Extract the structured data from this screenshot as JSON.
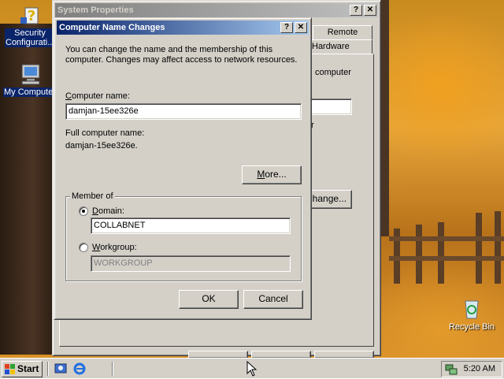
{
  "desktop": {
    "icons": [
      {
        "label": "Security Configurati...",
        "icon": "security-config-icon"
      },
      {
        "label": "My Computer",
        "icon": "my-computer-icon"
      },
      {
        "label": "Recycle Bin",
        "icon": "recycle-bin-icon"
      }
    ]
  },
  "system_properties": {
    "title": "System Properties",
    "tabs": [
      "Remote",
      "Hardware"
    ],
    "partial_text_1": "computer",
    "partial_text_2": "r",
    "change_button_label": "Change...",
    "title_buttons": [
      "?",
      "✕"
    ]
  },
  "dialog": {
    "title": "Computer Name Changes",
    "title_buttons": [
      "?",
      "✕"
    ],
    "description": "You can change the name and the membership of this computer. Changes may affect access to network resources.",
    "computer_name_label": "Computer name:",
    "computer_name_value": "damjan-15ee326e",
    "full_name_label": "Full computer name:",
    "full_name_value": "damjan-15ee326e.",
    "more_button": "More...",
    "member_of_label": "Member of",
    "domain_label": "Domain:",
    "domain_value": "COLLABNET",
    "domain_selected": true,
    "workgroup_label": "Workgroup:",
    "workgroup_value": "WORKGROUP",
    "ok_button": "OK",
    "cancel_button": "Cancel"
  },
  "taskbar": {
    "start_label": "Start",
    "quick_launch": [
      "show-desktop-icon",
      "internet-explorer-icon"
    ],
    "tray_icon": "network-icon",
    "clock": "5:20 AM"
  },
  "colors": {
    "title_active": "#0a246a",
    "title_inactive": "#808080",
    "face": "#d4d0c8"
  }
}
